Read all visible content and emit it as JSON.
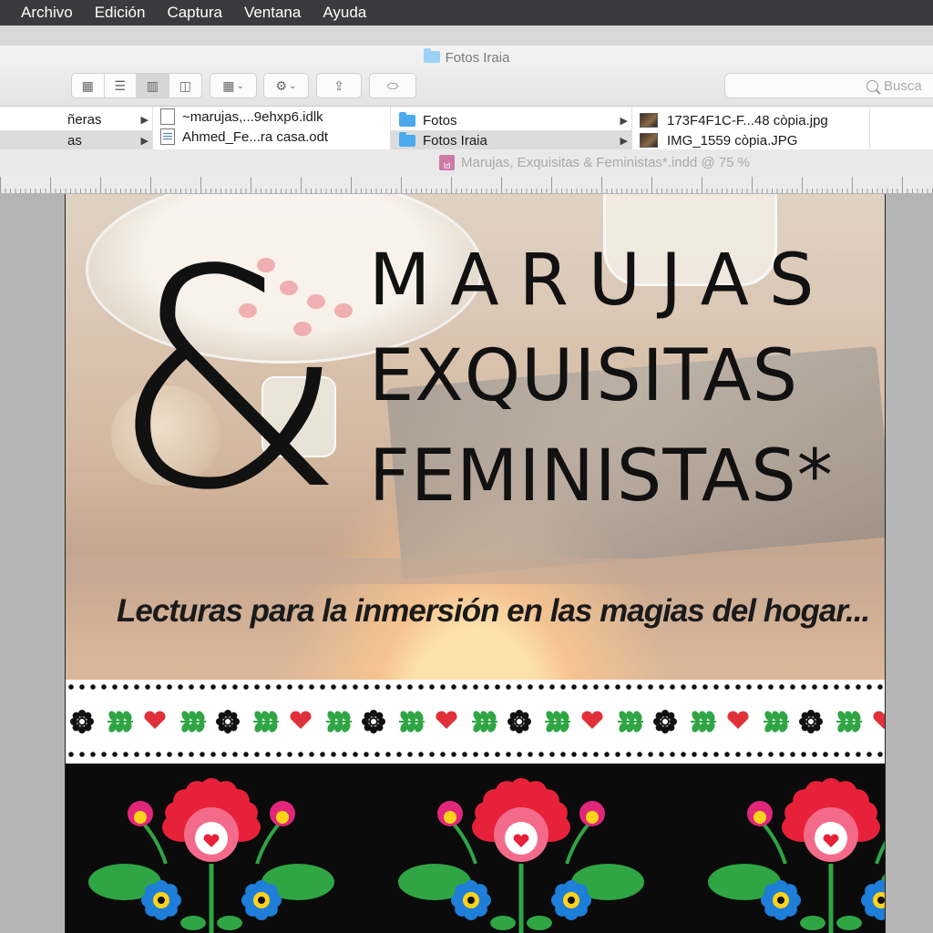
{
  "menubar": {
    "items": [
      "Archivo",
      "Edición",
      "Captura",
      "Ventana",
      "Ayuda"
    ]
  },
  "finder": {
    "window_title": "Fotos Iraia",
    "search_placeholder": "Busca",
    "columns": {
      "col1": [
        {
          "label": "ñeras",
          "selected": false
        },
        {
          "label": "as",
          "selected": true
        }
      ],
      "col2": [
        {
          "label": "~marujas,...9ehxp6.idlk"
        },
        {
          "label": "Ahmed_Fe...ra casa.odt"
        }
      ],
      "col3": [
        {
          "label": "Fotos",
          "selected": false
        },
        {
          "label": "Fotos Iraia",
          "selected": true
        }
      ],
      "col4": [
        {
          "label": "173F4F1C-F...48 còpia.jpg"
        },
        {
          "label": "IMG_1559 còpia.JPG"
        }
      ]
    }
  },
  "indesign": {
    "doc_title": "Marujas, Exquisitas & Feministas*.indd @ 75 %",
    "app_badge": "Id"
  },
  "cover": {
    "ampersand": "&",
    "title_line_1": "MARUJAS",
    "title_line_2": "EXQUISITAS",
    "title_line_3": "FEMINISTAS*",
    "subtitle": "Lecturas para la inmersión en las magias del hogar..."
  },
  "colors": {
    "menubar": "#3b3b3d",
    "finder_bg": "#ececec",
    "selection": "#dcdcdc",
    "folder_blue": "#4aa9ef",
    "folk_red": "#e0313a",
    "folk_green": "#2fa544",
    "flower_blue": "#1e7ed8",
    "flower_yellow": "#ffd31a",
    "flower_pink": "#e2267a"
  },
  "icons": [
    "icon-view-icon",
    "list-view-icon",
    "column-view-icon",
    "cover-flow-icon",
    "arrange-icon",
    "gear-icon",
    "share-icon",
    "tag-icon",
    "search-icon",
    "chevron-right-icon",
    "folder-icon",
    "document-icon",
    "image-thumbnail-icon",
    "indesign-doc-icon"
  ]
}
